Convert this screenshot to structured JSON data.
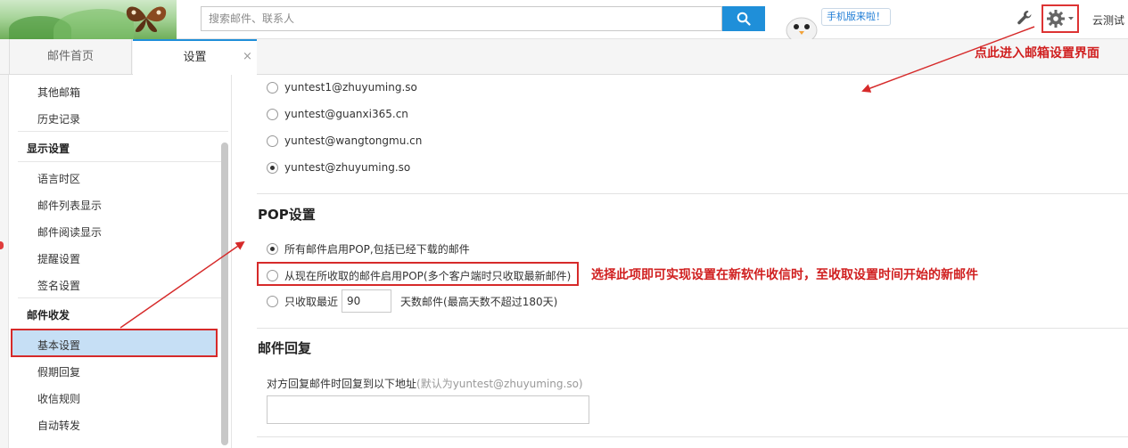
{
  "header": {
    "search_placeholder": "搜索邮件、联系人",
    "mobile_badge": "手机版来啦！",
    "user_name": "云测试"
  },
  "tabs": [
    {
      "label": "邮件首页"
    },
    {
      "label": "设置"
    }
  ],
  "tab_close": "×",
  "sidebar": {
    "items": [
      {
        "label": "其他邮箱"
      },
      {
        "label": "历史记录"
      },
      {
        "label": "显示设置"
      },
      {
        "label": "语言时区"
      },
      {
        "label": "邮件列表显示"
      },
      {
        "label": "邮件阅读显示"
      },
      {
        "label": "提醒设置"
      },
      {
        "label": "签名设置"
      },
      {
        "label": "邮件收发"
      },
      {
        "label": "基本设置"
      },
      {
        "label": "假期回复"
      },
      {
        "label": "收信规则"
      },
      {
        "label": "自动转发"
      }
    ]
  },
  "accounts": [
    {
      "label": "yuntest1@zhuyuming.so"
    },
    {
      "label": "yuntest@guanxi365.cn"
    },
    {
      "label": "yuntest@wangtongmu.cn"
    },
    {
      "label": "yuntest@zhuyuming.so"
    }
  ],
  "pop": {
    "title": "POP设置",
    "options": [
      {
        "label": "所有邮件启用POP,包括已经下载的邮件"
      },
      {
        "label": "从现在所收取的邮件启用POP(多个客户端时只收取最新邮件)"
      },
      {
        "label": "只收取最近"
      }
    ],
    "days_value": "90",
    "days_suffix": "天数邮件(最高天数不超过180天)"
  },
  "reply": {
    "title": "邮件回复",
    "text": "对方回复邮件时回复到以下地址",
    "hint": "(默认为yuntest@zhuyuming.so)"
  },
  "annotations": {
    "gear_note": "点此进入邮箱设置界面",
    "pop_note": "选择此项即可实现设置在新软件收信时，至收取设置时间开始的新邮件"
  },
  "colors": {
    "accent": "#1f8fd9",
    "annotation": "#d62a2a",
    "active_item": "#c6dff5"
  }
}
